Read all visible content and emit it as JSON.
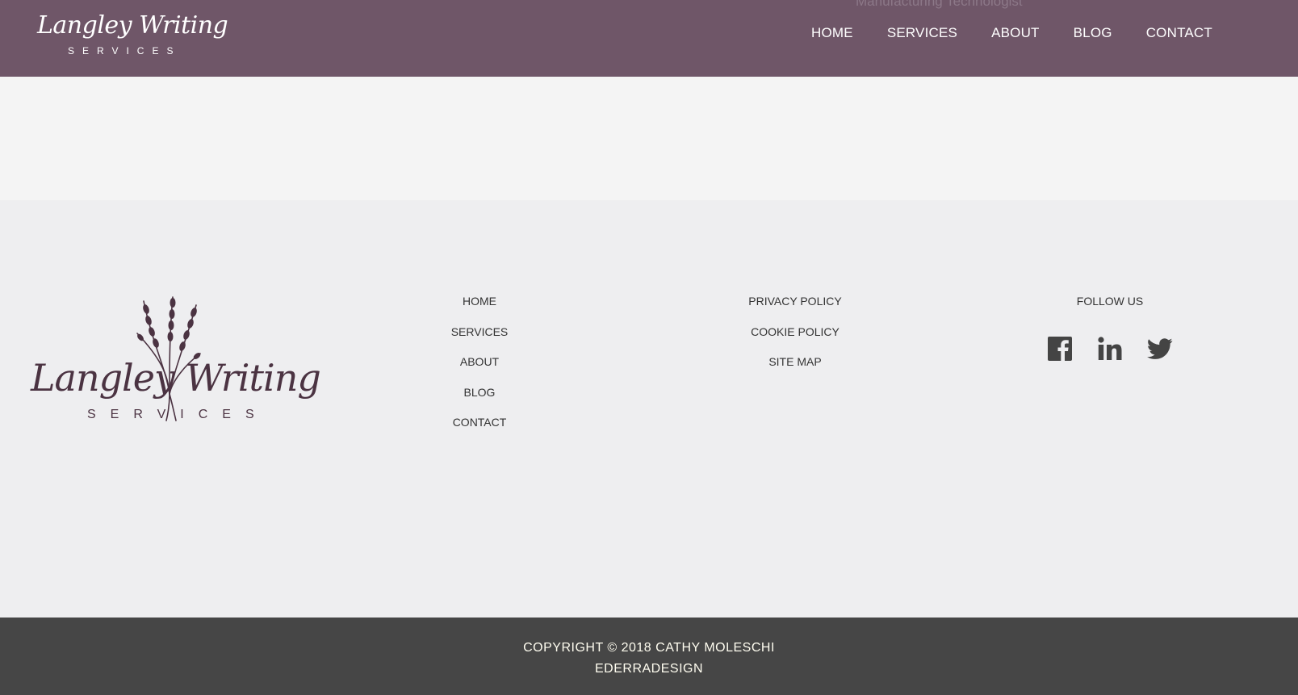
{
  "header": {
    "behind_text": "Manufacturing Technologist",
    "brand_script": "Langley Writing",
    "brand_sub": "SERVICES",
    "nav": [
      "HOME",
      "SERVICES",
      "ABOUT",
      "BLOG",
      "CONTACT"
    ]
  },
  "footer": {
    "logo_script": "Langley Writing",
    "logo_sub": "SERVICES",
    "links_col1": [
      "HOME",
      "SERVICES",
      "ABOUT",
      "BLOG",
      "CONTACT"
    ],
    "links_col2": [
      "PRIVACY POLICY",
      "COOKIE POLICY",
      "SITE MAP"
    ],
    "follow_heading": "FOLLOW US",
    "social_icons": [
      "facebook-icon",
      "linkedin-icon",
      "twitter-icon"
    ]
  },
  "copyright": {
    "line1": "COPYRIGHT © 2018 CATHY MOLESCHI",
    "line2": "EDERRADESIGN"
  },
  "colors": {
    "header_bg": "#6f5668",
    "band_bg": "#f4f4f4",
    "footer_bg": "#eeeef0",
    "bottom_bg": "#464646",
    "logo_color": "#4b3342"
  }
}
